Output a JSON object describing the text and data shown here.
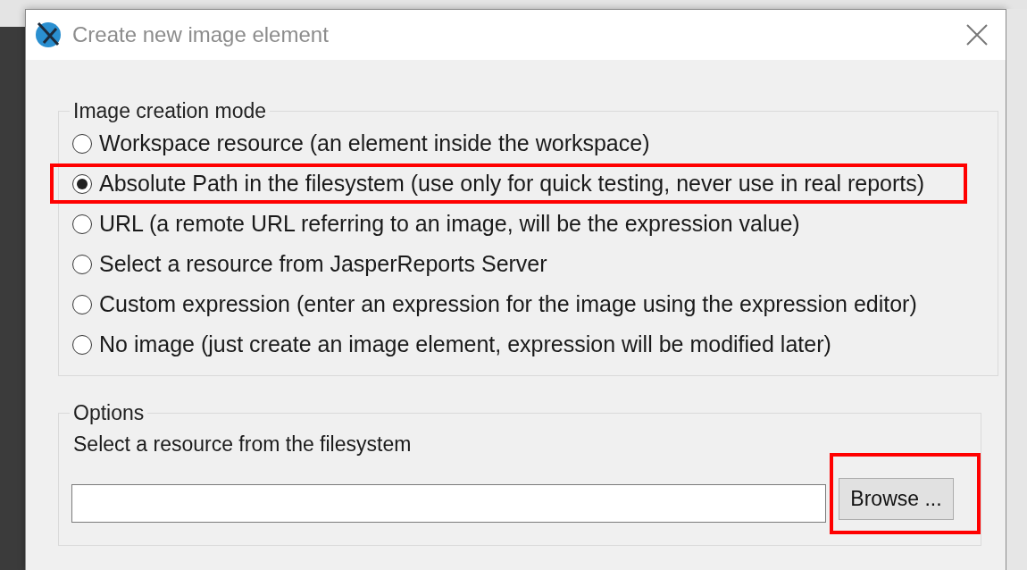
{
  "window": {
    "title": "Create new image element"
  },
  "mode_group": {
    "title": "Image creation mode",
    "options": [
      {
        "label": "Workspace resource (an element inside the workspace)",
        "selected": false,
        "highlighted": false
      },
      {
        "label": "Absolute Path in the filesystem (use only for quick testing, never use in real reports)",
        "selected": true,
        "highlighted": true
      },
      {
        "label": "URL (a remote URL referring to an image, will be the expression value)",
        "selected": false,
        "highlighted": false
      },
      {
        "label": "Select a resource from JasperReports Server",
        "selected": false,
        "highlighted": false
      },
      {
        "label": "Custom expression (enter an expression for the image using the expression editor)",
        "selected": false,
        "highlighted": false
      },
      {
        "label": "No image (just create an image element, expression will be modified later)",
        "selected": false,
        "highlighted": false
      }
    ]
  },
  "options_group": {
    "title": "Options",
    "label": "Select a resource from the filesystem",
    "browse_button": {
      "label": "Browse ...",
      "highlighted": true
    }
  }
}
